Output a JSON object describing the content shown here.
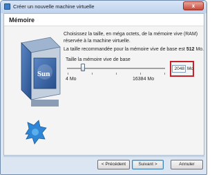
{
  "window": {
    "title": "Créer un nouvelle machine virtuelle",
    "close_label": "x"
  },
  "header": {
    "section_title": "Mémoire"
  },
  "body": {
    "description": "Choisissez la taille, en méga octets, de la mémoire vive (RAM) réservée à la machine virtuelle.",
    "recommendation_prefix": "La taille recommandée pour la mémoire vive de base est ",
    "recommendation_value": "512",
    "recommendation_unit": " Mo.",
    "slider_label": "Taille la mémoire vive de base",
    "slider_min_label": "4 Mo",
    "slider_max_label": "16384 Mo",
    "slider_min": 4,
    "slider_max": 16384,
    "memory_value": "2048",
    "memory_unit": "Mo"
  },
  "illustration": {
    "brand_text": "Sun"
  },
  "buttons": {
    "back": "< Précédent",
    "next": "Suivant >",
    "cancel": "Annuler"
  },
  "colors": {
    "highlight": "#c8202a",
    "accent": "#2f5d98"
  }
}
